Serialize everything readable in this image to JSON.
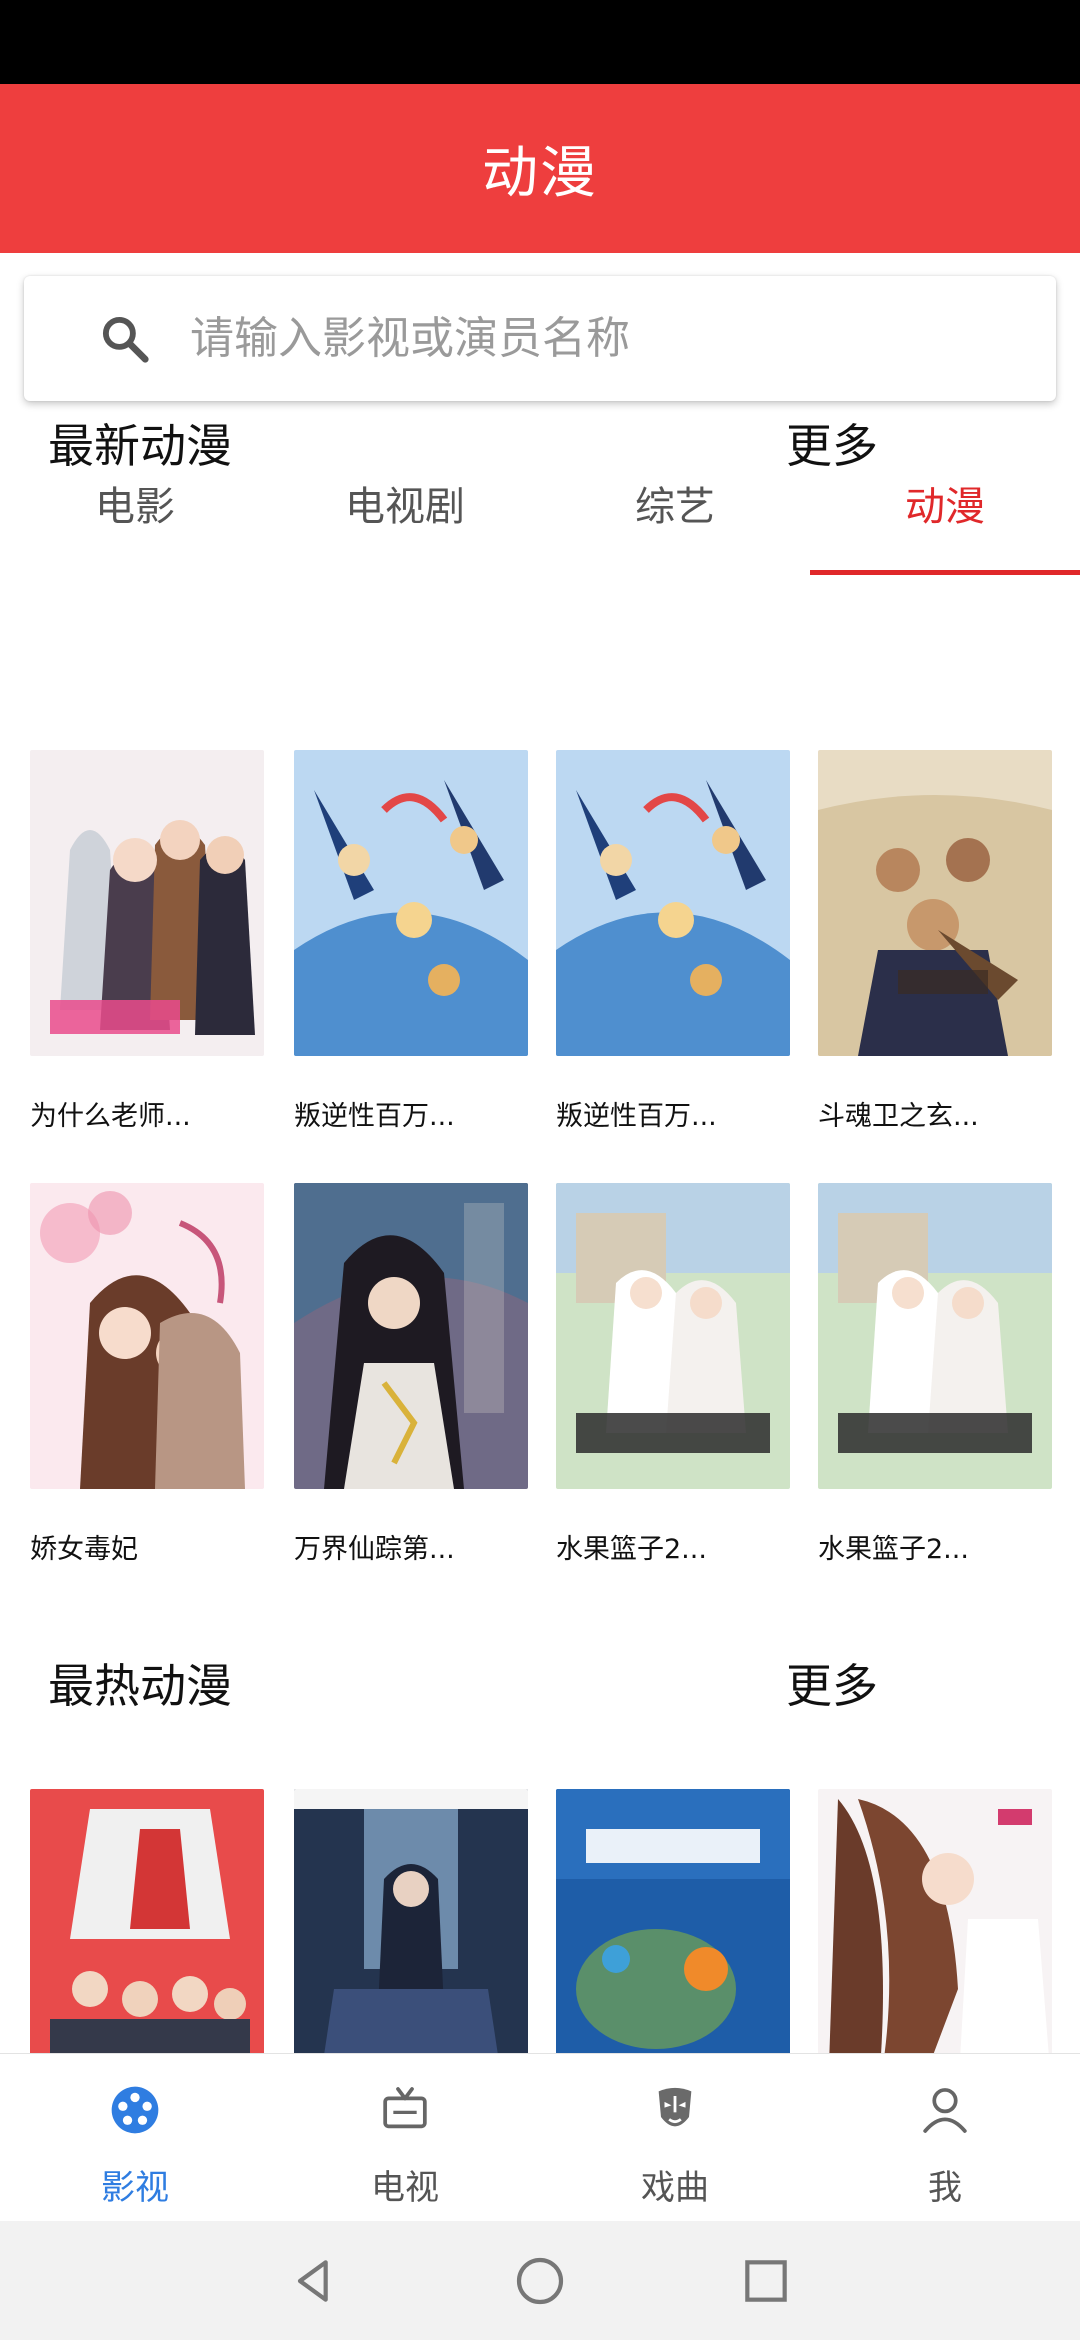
{
  "header": {
    "title": "动漫"
  },
  "search": {
    "placeholder": "请输入影视或演员名称"
  },
  "tabs": [
    {
      "label": "电影"
    },
    {
      "label": "电视剧"
    },
    {
      "label": "综艺"
    },
    {
      "label": "动漫",
      "active": true
    }
  ],
  "sections": [
    {
      "title": "最新动漫",
      "more": "更多",
      "items": [
        {
          "title": "为什么老师..."
        },
        {
          "title": "叛逆性百万..."
        },
        {
          "title": "叛逆性百万..."
        },
        {
          "title": "斗魂卫之玄..."
        },
        {
          "title": "娇女毒妃"
        },
        {
          "title": "万界仙踪第..."
        },
        {
          "title": "水果篮子2..."
        },
        {
          "title": "水果篮子2..."
        }
      ]
    },
    {
      "title": "最热动漫",
      "more": "更多",
      "items": []
    }
  ],
  "bottom_nav": [
    {
      "label": "影视",
      "icon": "film-reel-icon",
      "active": true
    },
    {
      "label": "电视",
      "icon": "tv-icon"
    },
    {
      "label": "戏曲",
      "icon": "opera-mask-icon"
    },
    {
      "label": "我",
      "icon": "person-icon"
    }
  ],
  "colors": {
    "accent": "#ee3e3e",
    "tab_active": "#e0282a",
    "nav_active": "#2f7de1"
  }
}
